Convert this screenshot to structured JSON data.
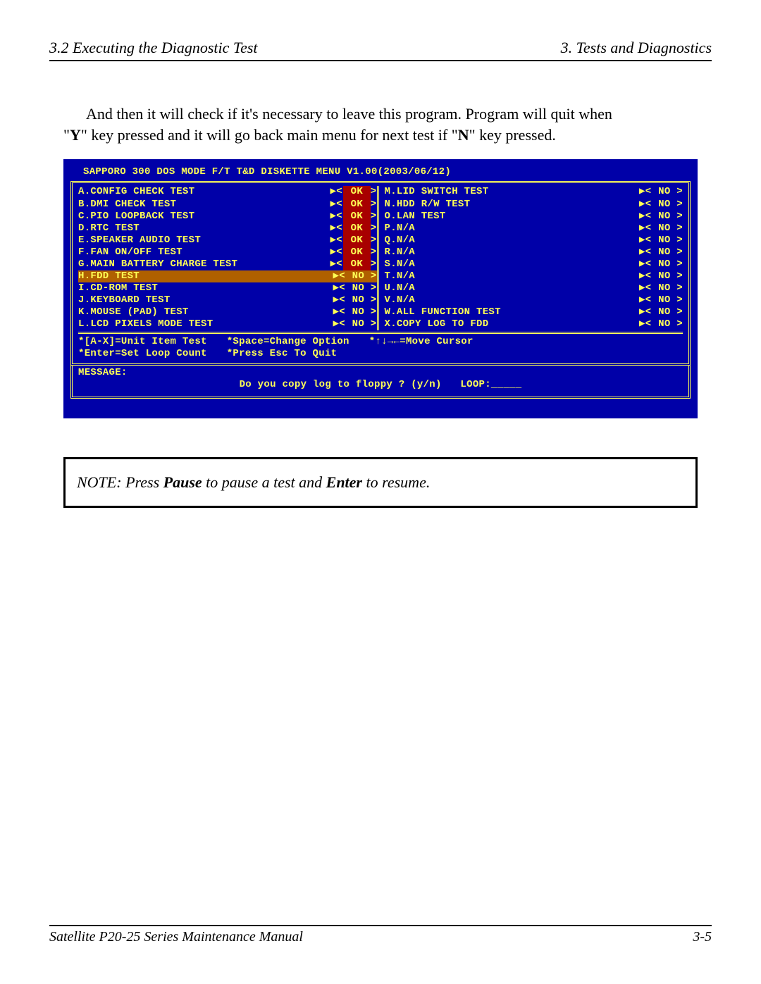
{
  "header": {
    "left": "3.2  Executing the Diagnostic Test",
    "right": "3.  Tests and Diagnostics"
  },
  "body": {
    "line1_pre": "And then it will check if it's necessary to leave this program. Program will quit when",
    "line2_a": "\"",
    "line2_Y": "Y",
    "line2_b": "\" key pressed and it will go back main menu for next test if \"",
    "line2_N": "N",
    "line2_c": "\" key pressed."
  },
  "dos": {
    "title": "SAPPORO 300 DOS MODE  F/T  T&D  DISKETTE MENU  V1.00(2003/06/12)",
    "left": [
      {
        "label": "A.CONFIG CHECK TEST",
        "status": "OK",
        "hl": false
      },
      {
        "label": "B.DMI CHECK TEST",
        "status": "OK",
        "hl": false
      },
      {
        "label": "C.PIO LOOPBACK TEST",
        "status": "OK",
        "hl": false
      },
      {
        "label": "D.RTC TEST",
        "status": "OK",
        "hl": false
      },
      {
        "label": "E.SPEAKER AUDIO TEST",
        "status": "OK",
        "hl": false
      },
      {
        "label": "F.FAN ON/OFF TEST",
        "status": "OK",
        "hl": false
      },
      {
        "label": "G.MAIN BATTERY CHARGE TEST",
        "status": "OK",
        "hl": false
      },
      {
        "label": "H.FDD TEST",
        "status": "NO",
        "hl": true
      },
      {
        "label": "I.CD-ROM TEST",
        "status": "NO",
        "hl": false
      },
      {
        "label": "J.KEYBOARD TEST",
        "status": "NO",
        "hl": false
      },
      {
        "label": "K.MOUSE (PAD) TEST",
        "status": "NO",
        "hl": false
      },
      {
        "label": "L.LCD PIXELS MODE TEST",
        "status": "NO",
        "hl": false
      }
    ],
    "right": [
      {
        "label": "M.LID SWITCH TEST",
        "status": "NO"
      },
      {
        "label": "N.HDD R/W TEST",
        "status": "NO"
      },
      {
        "label": "O.LAN TEST",
        "status": "NO"
      },
      {
        "label": "P.N/A",
        "status": "NO"
      },
      {
        "label": "Q.N/A",
        "status": "NO"
      },
      {
        "label": "R.N/A",
        "status": "NO"
      },
      {
        "label": "S.N/A",
        "status": "NO"
      },
      {
        "label": "T.N/A",
        "status": "NO"
      },
      {
        "label": "U.N/A",
        "status": "NO"
      },
      {
        "label": "V.N/A",
        "status": "NO"
      },
      {
        "label": "W.ALL FUNCTION TEST",
        "status": "NO"
      },
      {
        "label": "X.COPY LOG TO FDD",
        "status": "NO"
      }
    ],
    "help": {
      "h1": "*[A-X]=Unit Item Test",
      "h2": "*Space=Change Option",
      "h3": "*↑↓→←=Move Cursor",
      "h4": "*Enter=Set Loop Count",
      "h5": "*Press Esc To Quit"
    },
    "message_label": "MESSAGE:",
    "message_text": "Do you copy log to floppy ? (y/n)",
    "loop_label": "LOOP:_____"
  },
  "note": {
    "prefix": "NOTE:  ",
    "mid1": "Press ",
    "b1": "Pause",
    "mid2": " to pause a test and ",
    "b2": "Enter",
    "mid3": " to resume."
  },
  "footer": {
    "left": "Satellite P20-25 Series Maintenance Manual",
    "right": "3-5"
  }
}
